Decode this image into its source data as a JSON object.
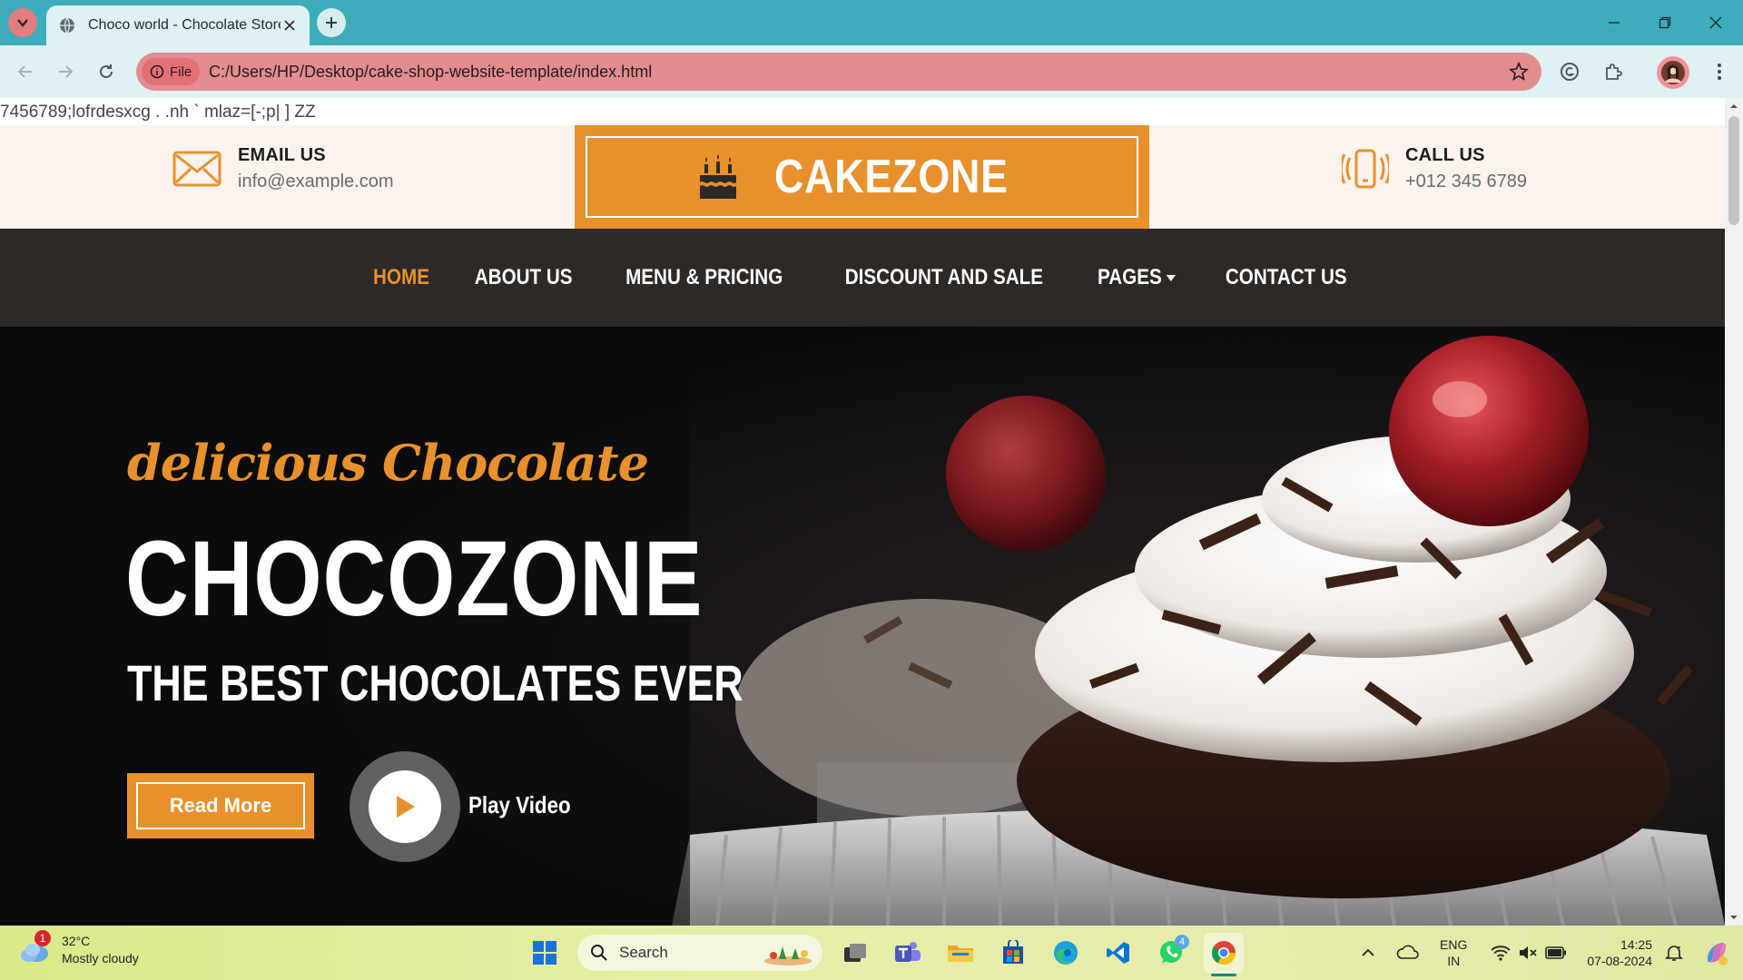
{
  "browser": {
    "tab_title": "Choco world - Chocolate Store",
    "chip_label": "File",
    "url": "C:/Users/HP/Desktop/cake-shop-website-template/index.html"
  },
  "page": {
    "typed_text": "7456789;lofrdesxcg . .nh ` mlaz=[-;p| ] ZZ",
    "email_title": "EMAIL US",
    "email_value": "info@example.com",
    "logo_text": "CAKEZONE",
    "call_title": "CALL US",
    "call_value": "+012 345 6789",
    "nav": [
      {
        "label": "HOME",
        "active": true
      },
      {
        "label": "ABOUT US"
      },
      {
        "label": "MENU & PRICING"
      },
      {
        "label": "DISCOUNT AND SALE"
      },
      {
        "label": "PAGES"
      },
      {
        "label": "CONTACT US"
      }
    ],
    "hero": {
      "subtitle": "delicious Chocolate",
      "title": "CHOCOZONE",
      "tagline": "THE BEST CHOCOLATES EVER",
      "read_more": "Read More",
      "play_video": "Play Video"
    },
    "colors": {
      "accent": "#e8912c",
      "dark_nav": "#2d2926",
      "topbar_bg": "#fbf4ee"
    }
  },
  "taskbar": {
    "weather_badge": "1",
    "temperature": "32°C",
    "condition": "Mostly cloudy",
    "search_label": "Search",
    "teams_badge": "",
    "whatsapp_badge": "4",
    "lang_line1": "ENG",
    "lang_line2": "IN",
    "time": "14:25",
    "date": "07-08-2024"
  }
}
